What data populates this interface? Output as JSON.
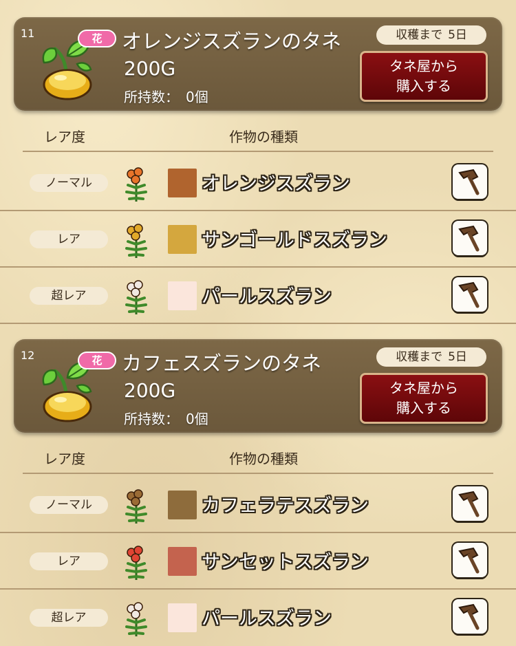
{
  "columns": {
    "rarity": "レア度",
    "crop": "作物の種類"
  },
  "sections": [
    {
      "number": "11",
      "tag": "花",
      "seed_name": "オレンジスズランのタネ",
      "price": "200G",
      "owned_label": "所持数：",
      "owned_value": "0個",
      "harvest_label": "収穫まで",
      "harvest_days": "5日",
      "buy_button_line1": "タネ屋から",
      "buy_button_line2": "購入する",
      "rows": [
        {
          "rarity": "ノーマル",
          "crop": "オレンジスズラン",
          "swatch_color": "#b0642e",
          "flower_color": "#e8742a",
          "icon": "hammer-icon"
        },
        {
          "rarity": "レア",
          "crop": "サンゴールドスズラン",
          "swatch_color": "#d4a73e",
          "flower_color": "#e2a92a",
          "icon": "hammer-icon"
        },
        {
          "rarity": "超レア",
          "crop": "パールスズラン",
          "swatch_color": "#fbe6dc",
          "flower_color": "#f0e8e2",
          "icon": "hammer-icon"
        }
      ]
    },
    {
      "number": "12",
      "tag": "花",
      "seed_name": "カフェスズランのタネ",
      "price": "200G",
      "owned_label": "所持数：",
      "owned_value": "0個",
      "harvest_label": "収穫まで",
      "harvest_days": "5日",
      "buy_button_line1": "タネ屋から",
      "buy_button_line2": "購入する",
      "rows": [
        {
          "rarity": "ノーマル",
          "crop": "カフェラテスズラン",
          "swatch_color": "#8e6c3c",
          "flower_color": "#9a6b35",
          "icon": "hammer-icon"
        },
        {
          "rarity": "レア",
          "crop": "サンセットスズラン",
          "swatch_color": "#c4634e",
          "flower_color": "#e04434",
          "icon": "hammer-icon"
        },
        {
          "rarity": "超レア",
          "crop": "パールスズラン",
          "swatch_color": "#fbe6dc",
          "flower_color": "#f0e8e2",
          "icon": "hammer-icon"
        }
      ]
    }
  ]
}
